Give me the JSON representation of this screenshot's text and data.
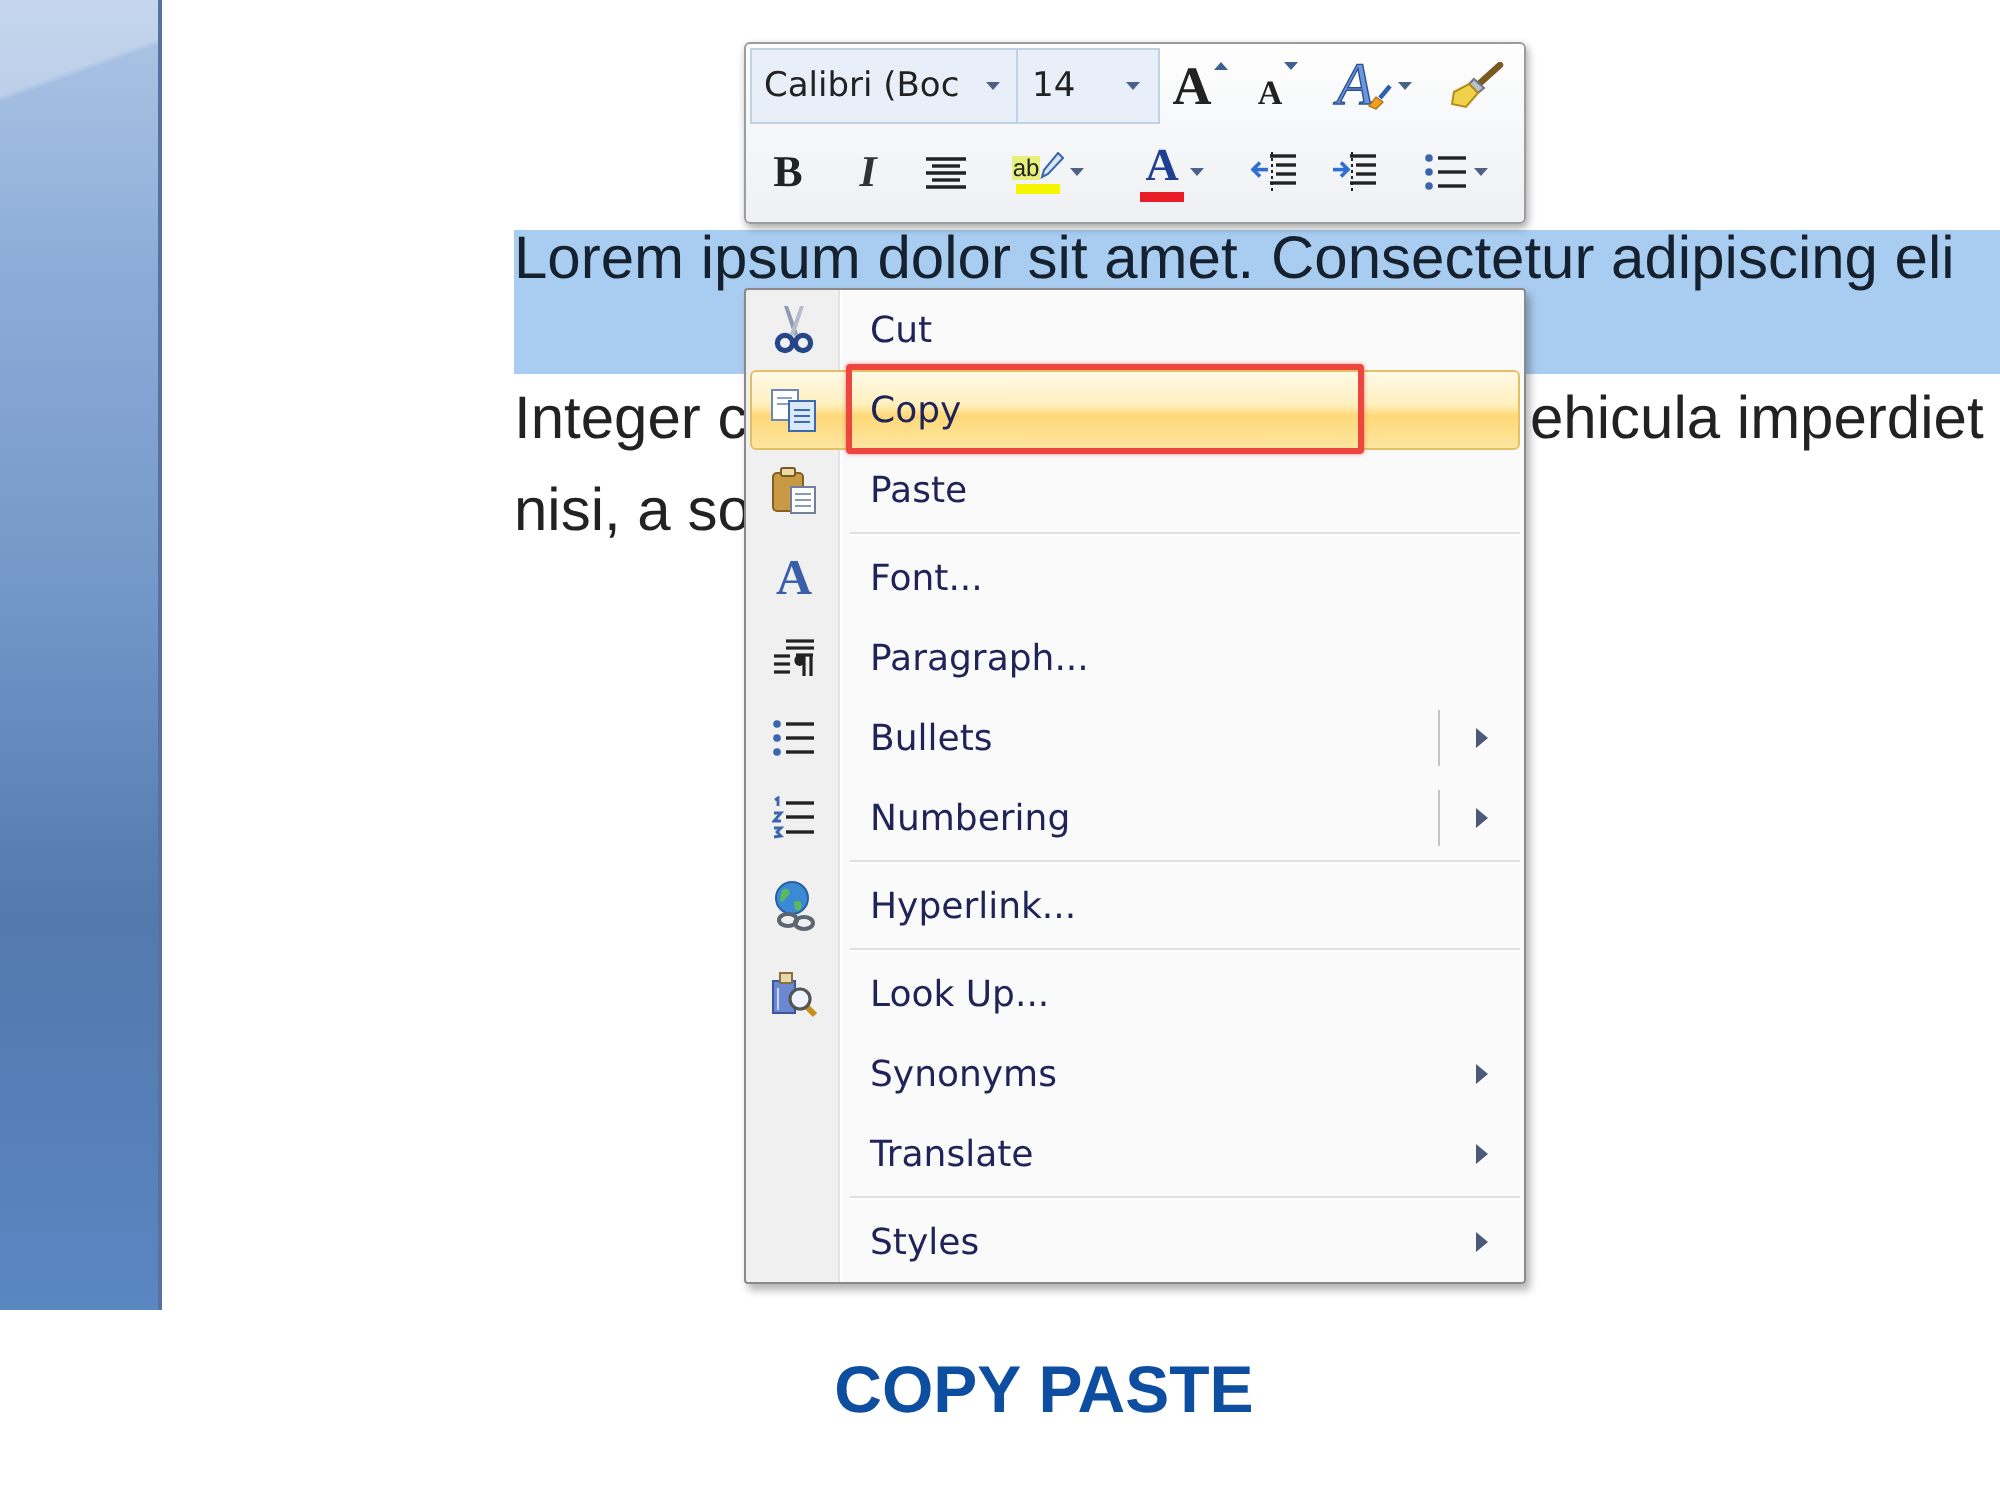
{
  "mini_toolbar": {
    "font_name": {
      "value": "Calibri (Boc"
    },
    "font_size": {
      "value": "14"
    },
    "top_buttons": [
      {
        "kind": "grow",
        "glyph": "A",
        "dropdown": false
      },
      {
        "kind": "shrink",
        "glyph": "A",
        "dropdown": false
      },
      {
        "kind": "styles",
        "glyph": "A",
        "dropdown": true
      },
      {
        "kind": "painter",
        "dropdown": false
      }
    ],
    "bottom_buttons": [
      {
        "kind": "bold",
        "glyph": "B",
        "dropdown": false
      },
      {
        "kind": "italic",
        "glyph": "I",
        "dropdown": false
      },
      {
        "kind": "center",
        "dropdown": false
      },
      {
        "kind": "highlighter",
        "glyph": "ab",
        "color": "#f5f500",
        "dropdown": true
      },
      {
        "kind": "color",
        "glyph": "A",
        "color": "#e81c24",
        "dropdown": true
      },
      {
        "kind": "outdent",
        "dropdown": false
      },
      {
        "kind": "indent",
        "dropdown": false
      },
      {
        "kind": "bullets",
        "dropdown": true
      }
    ]
  },
  "document": {
    "lines": [
      {
        "selected": true,
        "segments": [
          "Lorem ipsum dolor sit amet. Consectetur adipiscing eli"
        ]
      },
      {
        "selected": false,
        "segments": [
          "Integer c",
          "ehicula imperdiet"
        ]
      },
      {
        "selected": false,
        "segments": [
          "nisi, a so"
        ]
      }
    ]
  },
  "context_menu": {
    "sections": [
      {
        "items": [
          {
            "label": "Cut",
            "kind": "command",
            "selected": false,
            "outlined": false
          },
          {
            "label": "Copy",
            "kind": "command",
            "selected": true,
            "outlined": true
          },
          {
            "label": "Paste",
            "kind": "command",
            "selected": false,
            "outlined": false
          }
        ]
      },
      {
        "items": [
          {
            "label": "Font...",
            "glyph": "A",
            "kind": "command",
            "selected": false,
            "outlined": false
          },
          {
            "label": "Paragraph...",
            "kind": "command",
            "selected": false,
            "outlined": false
          },
          {
            "label": "Bullets",
            "kind": "split",
            "selected": false,
            "outlined": false
          },
          {
            "label": "Numbering",
            "kind": "split",
            "selected": false,
            "outlined": false
          }
        ]
      },
      {
        "items": [
          {
            "label": "Hyperlink...",
            "kind": "command",
            "selected": false,
            "outlined": false
          }
        ]
      },
      {
        "items": [
          {
            "label": "Look Up...",
            "kind": "command",
            "selected": false,
            "outlined": false
          },
          {
            "label": "Synonyms",
            "kind": "submenu",
            "selected": false,
            "outlined": false
          },
          {
            "label": "Translate",
            "kind": "submenu",
            "selected": false,
            "outlined": false
          }
        ]
      },
      {
        "items": [
          {
            "label": "Styles",
            "kind": "submenu",
            "selected": false,
            "outlined": false
          }
        ]
      }
    ]
  },
  "caption": "COPY PASTE"
}
